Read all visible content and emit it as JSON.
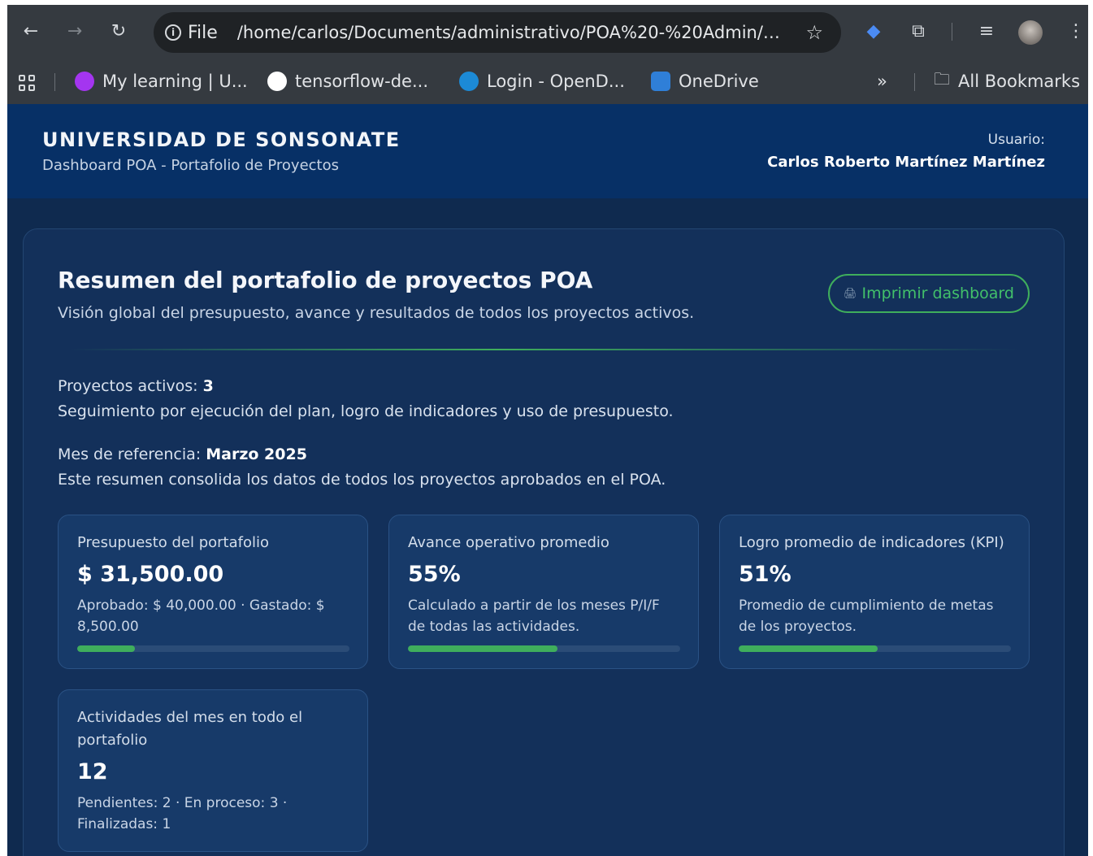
{
  "browser": {
    "url_chip": "File",
    "url": "/home/carlos/Documents/administrativo/POA%20-%20Admin/page...",
    "bookmarks": [
      {
        "label": "My learning | U...",
        "color": "#a435f0"
      },
      {
        "label": "tensorflow-de...",
        "color": "#ffffff"
      },
      {
        "label": "Login - OpenD...",
        "color": "#1c8ad6"
      },
      {
        "label": "OneDrive",
        "color": "#2f7fd8"
      }
    ],
    "overflow": "»",
    "all_bookmarks": "All Bookmarks"
  },
  "header": {
    "title": "UNIVERSIDAD DE SONSONATE",
    "subtitle": "Dashboard POA - Portafolio de Proyectos",
    "user_label": "Usuario:",
    "user_name": "Carlos Roberto Martínez Martínez"
  },
  "summary": {
    "title": "Resumen del portafolio de proyectos POA",
    "subtitle": "Visión global del presupuesto, avance y resultados de todos los proyectos activos.",
    "print_button": "Imprimir dashboard",
    "active_label": "Proyectos activos: ",
    "active_value": "3",
    "tracking_text": "Seguimiento por ejecución del plan, logro de indicadores y uso de presupuesto.",
    "month_label": "Mes de referencia: ",
    "month_value": "Marzo 2025",
    "month_text": "Este resumen consolida los datos de todos los proyectos aprobados en el POA."
  },
  "cards": [
    {
      "label": "Presupuesto del portafolio",
      "value": "$ 31,500.00",
      "desc": "Aprobado: $ 40,000.00 · Gastado: $ 8,500.00",
      "progress": 0.2125
    },
    {
      "label": "Avance operativo promedio",
      "value": "55%",
      "desc": "Calculado a partir de los meses P/I/F de todas las actividades.",
      "progress": 0.55
    },
    {
      "label": "Logro promedio de indicadores (KPI)",
      "value": "51%",
      "desc": "Promedio de cumplimiento de metas de los proyectos.",
      "progress": 0.51
    },
    {
      "label": "Actividades del mes en todo el portafolio",
      "value": "12",
      "desc": "Pendientes: 2 · En proceso: 3 · Finalizadas: 1"
    }
  ],
  "colors": {
    "accent": "#3fae5c",
    "header_bg": "#073066",
    "page_bg": "#0f2a4f"
  }
}
